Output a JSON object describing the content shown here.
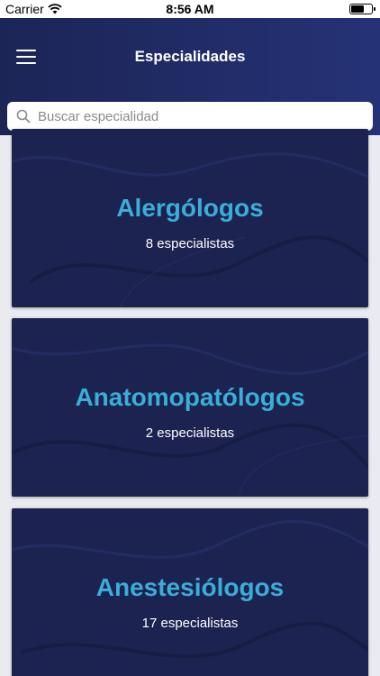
{
  "status_bar": {
    "carrier": "Carrier",
    "time": "8:56 AM"
  },
  "header": {
    "title": "Especialidades"
  },
  "search": {
    "placeholder": "Buscar especialidad"
  },
  "specialties": [
    {
      "name": "Alergólogos",
      "count": "8 especialistas"
    },
    {
      "name": "Anatomopatólogos",
      "count": "2 especialistas"
    },
    {
      "name": "Anestesiólogos",
      "count": "17 especialistas"
    }
  ],
  "colors": {
    "nav_start": "#1c2556",
    "nav_end": "#253276",
    "card_bg": "#1c2350",
    "accent": "#3aaed8"
  }
}
